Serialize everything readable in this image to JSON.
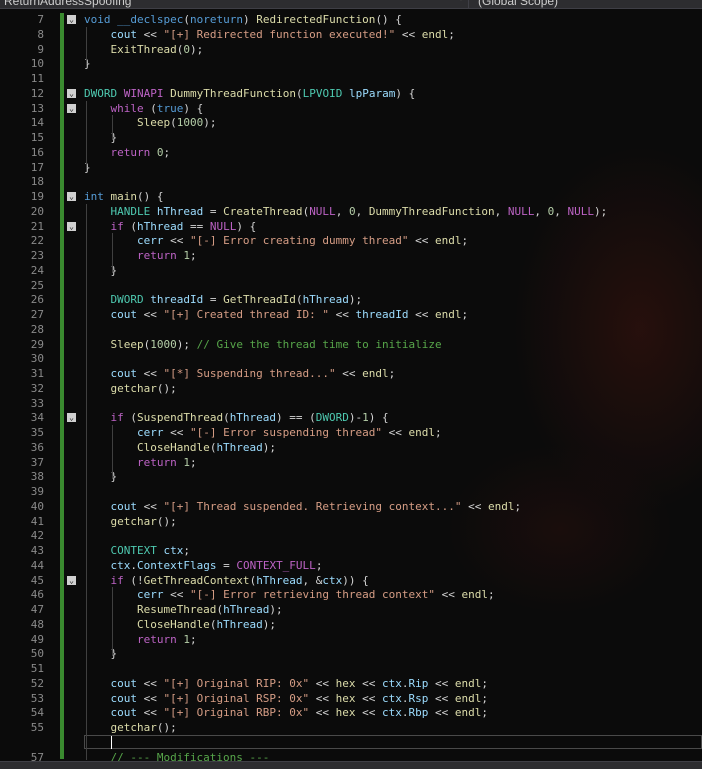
{
  "toolbar": {
    "project_dropdown": "ReturnAddressSpoofing",
    "scope_dropdown": "(Global Scope)"
  },
  "editor": {
    "lines": [
      {
        "n": "7",
        "fold": true,
        "indent": 0,
        "html": "<span class='k'>void</span> <span class='k'>__declspec</span>(<span class='k'>noreturn</span>) <span class='f'>RedirectedFunction</span>() {"
      },
      {
        "n": "8",
        "fold": false,
        "indent": 1,
        "html": "<span class='v'>cout</span> &lt;&lt; <span class='s'>\"[+] Redirected function executed!\"</span> &lt;&lt; <span class='f'>endl</span>;"
      },
      {
        "n": "9",
        "fold": false,
        "indent": 1,
        "html": "<span class='f'>ExitThread</span>(<span class='n'>0</span>);"
      },
      {
        "n": "10",
        "fold": false,
        "indent": 0,
        "html": "}"
      },
      {
        "n": "11",
        "fold": false,
        "indent": 0,
        "html": ""
      },
      {
        "n": "12",
        "fold": true,
        "indent": 0,
        "html": "<span class='t'>DWORD</span> <span class='m'>WINAPI</span> <span class='f'>DummyThreadFunction</span>(<span class='t'>LPVOID</span> <span class='v'>lpParam</span>) {"
      },
      {
        "n": "13",
        "fold": true,
        "indent": 1,
        "html": "<span class='m'>while</span> (<span class='k'>true</span>) {"
      },
      {
        "n": "14",
        "fold": false,
        "indent": 2,
        "html": "<span class='f'>Sleep</span>(<span class='n'>1000</span>);"
      },
      {
        "n": "15",
        "fold": false,
        "indent": 1,
        "html": "}"
      },
      {
        "n": "16",
        "fold": false,
        "indent": 1,
        "html": "<span class='m'>return</span> <span class='n'>0</span>;"
      },
      {
        "n": "17",
        "fold": false,
        "indent": 0,
        "html": "}"
      },
      {
        "n": "18",
        "fold": false,
        "indent": 0,
        "html": ""
      },
      {
        "n": "19",
        "fold": true,
        "indent": 0,
        "html": "<span class='k'>int</span> <span class='f'>main</span>() {"
      },
      {
        "n": "20",
        "fold": false,
        "indent": 1,
        "html": "<span class='t'>HANDLE</span> <span class='v'>hThread</span> = <span class='f'>CreateThread</span>(<span class='m'>NULL</span>, <span class='n'>0</span>, <span class='f'>DummyThreadFunction</span>, <span class='m'>NULL</span>, <span class='n'>0</span>, <span class='m'>NULL</span>);"
      },
      {
        "n": "21",
        "fold": true,
        "indent": 1,
        "html": "<span class='m'>if</span> (<span class='v'>hThread</span> == <span class='m'>NULL</span>) {"
      },
      {
        "n": "22",
        "fold": false,
        "indent": 2,
        "html": "<span class='v'>cerr</span> &lt;&lt; <span class='s'>\"[-] Error creating dummy thread\"</span> &lt;&lt; <span class='f'>endl</span>;"
      },
      {
        "n": "23",
        "fold": false,
        "indent": 2,
        "html": "<span class='m'>return</span> <span class='n'>1</span>;"
      },
      {
        "n": "24",
        "fold": false,
        "indent": 1,
        "html": "}"
      },
      {
        "n": "25",
        "fold": false,
        "indent": 0,
        "html": ""
      },
      {
        "n": "26",
        "fold": false,
        "indent": 1,
        "html": "<span class='t'>DWORD</span> <span class='v'>threadId</span> = <span class='f'>GetThreadId</span>(<span class='v'>hThread</span>);"
      },
      {
        "n": "27",
        "fold": false,
        "indent": 1,
        "html": "<span class='v'>cout</span> &lt;&lt; <span class='s'>\"[+] Created thread ID: \"</span> &lt;&lt; <span class='v'>threadId</span> &lt;&lt; <span class='f'>endl</span>;"
      },
      {
        "n": "28",
        "fold": false,
        "indent": 0,
        "html": ""
      },
      {
        "n": "29",
        "fold": false,
        "indent": 1,
        "html": "<span class='f'>Sleep</span>(<span class='n'>1000</span>); <span class='c'>// Give the thread time to initialize</span>"
      },
      {
        "n": "30",
        "fold": false,
        "indent": 0,
        "html": ""
      },
      {
        "n": "31",
        "fold": false,
        "indent": 1,
        "html": "<span class='v'>cout</span> &lt;&lt; <span class='s'>\"[*] Suspending thread...\"</span> &lt;&lt; <span class='f'>endl</span>;"
      },
      {
        "n": "32",
        "fold": false,
        "indent": 1,
        "html": "<span class='f'>getchar</span>();"
      },
      {
        "n": "33",
        "fold": false,
        "indent": 0,
        "html": ""
      },
      {
        "n": "34",
        "fold": true,
        "indent": 1,
        "html": "<span class='m'>if</span> (<span class='f'>SuspendThread</span>(<span class='v'>hThread</span>) == (<span class='t'>DWORD</span>)-<span class='n'>1</span>) {"
      },
      {
        "n": "35",
        "fold": false,
        "indent": 2,
        "html": "<span class='v'>cerr</span> &lt;&lt; <span class='s'>\"[-] Error suspending thread\"</span> &lt;&lt; <span class='f'>endl</span>;"
      },
      {
        "n": "36",
        "fold": false,
        "indent": 2,
        "html": "<span class='f'>CloseHandle</span>(<span class='v'>hThread</span>);"
      },
      {
        "n": "37",
        "fold": false,
        "indent": 2,
        "html": "<span class='m'>return</span> <span class='n'>1</span>;"
      },
      {
        "n": "38",
        "fold": false,
        "indent": 1,
        "html": "}"
      },
      {
        "n": "39",
        "fold": false,
        "indent": 0,
        "html": ""
      },
      {
        "n": "40",
        "fold": false,
        "indent": 1,
        "html": "<span class='v'>cout</span> &lt;&lt; <span class='s'>\"[+] Thread suspended. Retrieving context...\"</span> &lt;&lt; <span class='f'>endl</span>;"
      },
      {
        "n": "41",
        "fold": false,
        "indent": 1,
        "html": "<span class='f'>getchar</span>();"
      },
      {
        "n": "42",
        "fold": false,
        "indent": 0,
        "html": ""
      },
      {
        "n": "43",
        "fold": false,
        "indent": 1,
        "html": "<span class='t'>CONTEXT</span> <span class='v'>ctx</span>;"
      },
      {
        "n": "44",
        "fold": false,
        "indent": 1,
        "html": "<span class='v'>ctx</span>.<span class='v'>ContextFlags</span> = <span class='m'>CONTEXT_FULL</span>;"
      },
      {
        "n": "45",
        "fold": true,
        "indent": 1,
        "html": "<span class='m'>if</span> (!<span class='f'>GetThreadContext</span>(<span class='v'>hThread</span>, &amp;<span class='v'>ctx</span>)) {"
      },
      {
        "n": "46",
        "fold": false,
        "indent": 2,
        "html": "<span class='v'>cerr</span> &lt;&lt; <span class='s'>\"[-] Error retrieving thread context\"</span> &lt;&lt; <span class='f'>endl</span>;"
      },
      {
        "n": "47",
        "fold": false,
        "indent": 2,
        "html": "<span class='f'>ResumeThread</span>(<span class='v'>hThread</span>);"
      },
      {
        "n": "48",
        "fold": false,
        "indent": 2,
        "html": "<span class='f'>CloseHandle</span>(<span class='v'>hThread</span>);"
      },
      {
        "n": "49",
        "fold": false,
        "indent": 2,
        "html": "<span class='m'>return</span> <span class='n'>1</span>;"
      },
      {
        "n": "50",
        "fold": false,
        "indent": 1,
        "html": "}"
      },
      {
        "n": "51",
        "fold": false,
        "indent": 0,
        "html": ""
      },
      {
        "n": "52",
        "fold": false,
        "indent": 1,
        "html": "<span class='v'>cout</span> &lt;&lt; <span class='s'>\"[+] Original RIP: 0x\"</span> &lt;&lt; <span class='f'>hex</span> &lt;&lt; <span class='v'>ctx</span>.<span class='v'>Rip</span> &lt;&lt; <span class='f'>endl</span>;"
      },
      {
        "n": "53",
        "fold": false,
        "indent": 1,
        "html": "<span class='v'>cout</span> &lt;&lt; <span class='s'>\"[+] Original RSP: 0x\"</span> &lt;&lt; <span class='f'>hex</span> &lt;&lt; <span class='v'>ctx</span>.<span class='v'>Rsp</span> &lt;&lt; <span class='f'>endl</span>;"
      },
      {
        "n": "54",
        "fold": false,
        "indent": 1,
        "html": "<span class='v'>cout</span> &lt;&lt; <span class='s'>\"[+] Original RBP: 0x\"</span> &lt;&lt; <span class='f'>hex</span> &lt;&lt; <span class='v'>ctx</span>.<span class='v'>Rbp</span> &lt;&lt; <span class='f'>endl</span>;"
      },
      {
        "n": "55",
        "fold": false,
        "indent": 1,
        "html": "<span class='f'>getchar</span>();"
      },
      {
        "n": "",
        "fold": false,
        "indent": 0,
        "html": "",
        "cursor": true
      },
      {
        "n": "57",
        "fold": false,
        "indent": 1,
        "html": "<span class='c'>// --- Modifications ---</span>"
      }
    ]
  }
}
